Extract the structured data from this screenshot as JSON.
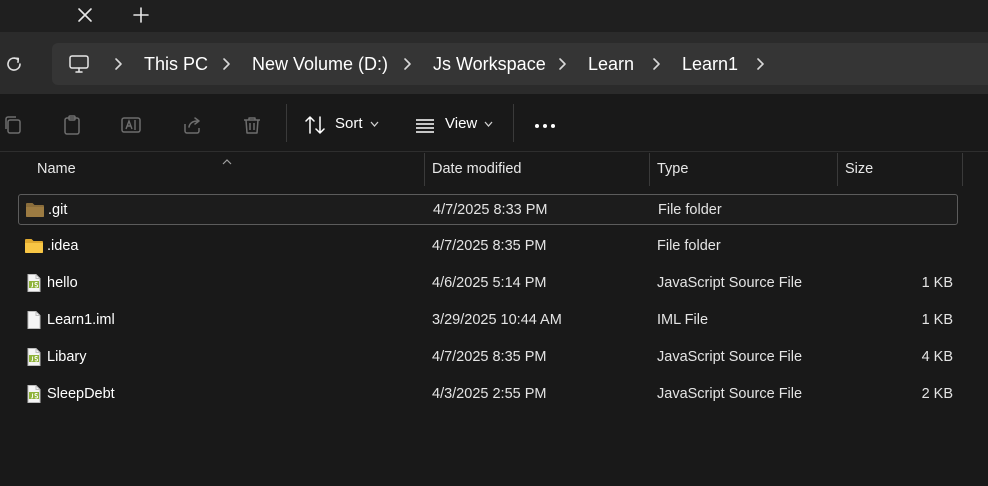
{
  "breadcrumb": [
    "This PC",
    "New Volume (D:)",
    "Js Workspace",
    "Learn",
    "Learn1"
  ],
  "toolbar": {
    "sort_label": "Sort",
    "view_label": "View"
  },
  "columns": {
    "name": "Name",
    "date": "Date modified",
    "type": "Type",
    "size": "Size"
  },
  "files": [
    {
      "name": ".git",
      "date": "4/7/2025 8:33 PM",
      "type": "File folder",
      "size": "",
      "icon": "folder-icon",
      "selected": true
    },
    {
      "name": ".idea",
      "date": "4/7/2025 8:35 PM",
      "type": "File folder",
      "size": "",
      "icon": "folder-icon",
      "selected": false
    },
    {
      "name": "hello",
      "date": "4/6/2025 5:14 PM",
      "type": "JavaScript Source File",
      "size": "1 KB",
      "icon": "js-file-icon",
      "selected": false
    },
    {
      "name": "Learn1.iml",
      "date": "3/29/2025 10:44 AM",
      "type": "IML File",
      "size": "1 KB",
      "icon": "file-icon",
      "selected": false
    },
    {
      "name": "Libary",
      "date": "4/7/2025 8:35 PM",
      "type": "JavaScript Source File",
      "size": "4 KB",
      "icon": "js-file-icon",
      "selected": false
    },
    {
      "name": "SleepDebt",
      "date": "4/3/2025 2:55 PM",
      "type": "JavaScript Source File",
      "size": "2 KB",
      "icon": "js-file-icon",
      "selected": false
    }
  ],
  "colors": {
    "folder_selected": "#8a6d3b",
    "folder": "#f8c645",
    "js_badge": "#8fb33a",
    "window_bg": "#191919"
  }
}
